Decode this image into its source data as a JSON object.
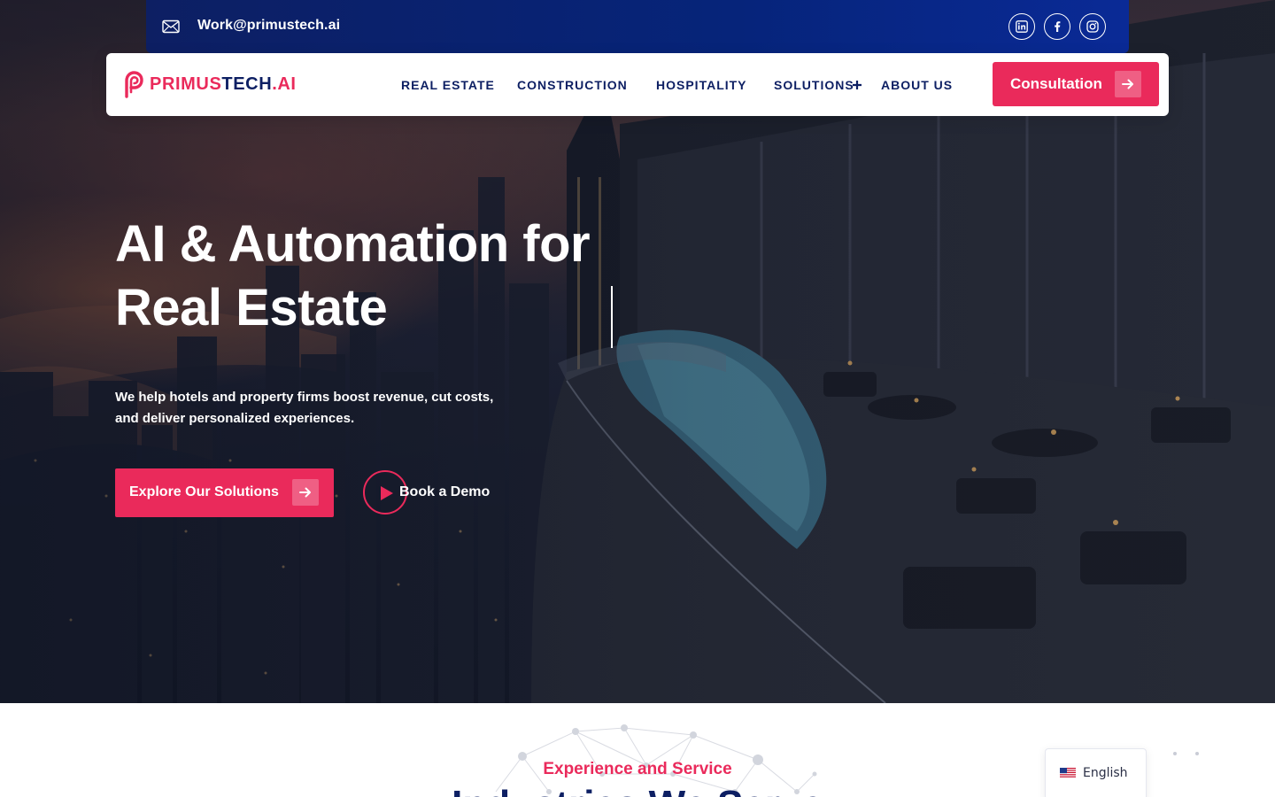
{
  "colors": {
    "brand_pink": "#ea2a5b",
    "brand_navy": "#0d1f63",
    "topbar_blue": "#06247a",
    "white": "#ffffff"
  },
  "topbar": {
    "email": "Work@primustech.ai",
    "email_icon": "envelope-icon",
    "social": [
      {
        "name": "linkedin",
        "icon": "linkedin-icon"
      },
      {
        "name": "facebook",
        "icon": "facebook-icon"
      },
      {
        "name": "instagram",
        "icon": "instagram-icon"
      }
    ]
  },
  "header": {
    "logo": {
      "part1": "PRIMUS",
      "part2": "TECH",
      "part3": ".AI",
      "icon": "brand-p-logo-icon"
    },
    "nav": [
      {
        "label": "REAL ESTATE"
      },
      {
        "label": "CONSTRUCTION"
      },
      {
        "label": "HOSPITALITY"
      },
      {
        "label": "SOLUTIONS",
        "has_submenu": true,
        "submenu_icon": "plus-icon"
      },
      {
        "label": "ABOUT US"
      }
    ],
    "cta": {
      "label": "Consultation",
      "icon": "arrow-right-icon"
    }
  },
  "hero": {
    "headline_line1": "AI & Automation for",
    "headline_line2": "Real Estate",
    "subtext_line1": "We help hotels and property firms boost revenue, cut costs,",
    "subtext_line2": "and deliver personalized experiences.",
    "primary_button": {
      "label": "Explore Our Solutions",
      "icon": "arrow-right-icon"
    },
    "secondary_button": {
      "label": "Book a Demo",
      "icon": "play-icon"
    },
    "background": "city-skyline-rooftop-pool-photo"
  },
  "section": {
    "eyebrow": "Experience and Service",
    "title": "Industries We Serve"
  },
  "language_switcher": {
    "label": "English",
    "flag": "us-flag-icon"
  }
}
